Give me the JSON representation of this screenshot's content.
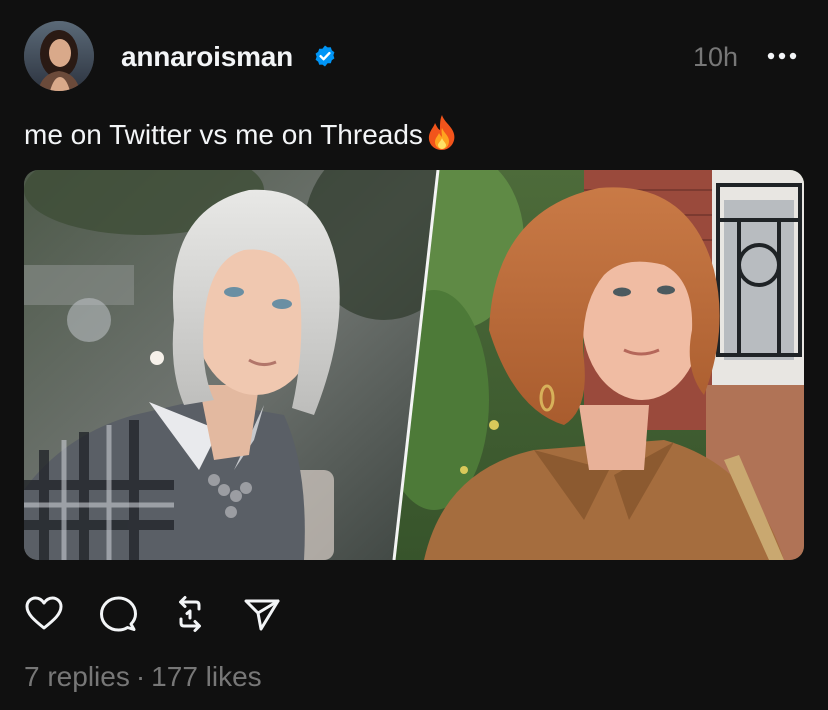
{
  "post": {
    "username": "annaroisman",
    "verified": true,
    "timestamp": "10h",
    "caption": "me on Twitter vs me on Threads",
    "caption_emoji": "fire",
    "media": {
      "left_image": "woman-with-white-bob-plaid-shirt",
      "right_image": "woman-with-copper-bob-brown-shirt"
    },
    "stats": {
      "replies": "7 replies",
      "separator": "·",
      "likes": "177 likes"
    }
  },
  "actions": {
    "like_icon": "heart-icon",
    "reply_icon": "comment-icon",
    "repost_icon": "repost-icon",
    "share_icon": "send-icon"
  },
  "colors": {
    "background": "#101010",
    "text_primary": "#f3f5f7",
    "text_secondary": "#777777",
    "verified_blue": "#0095f6"
  }
}
